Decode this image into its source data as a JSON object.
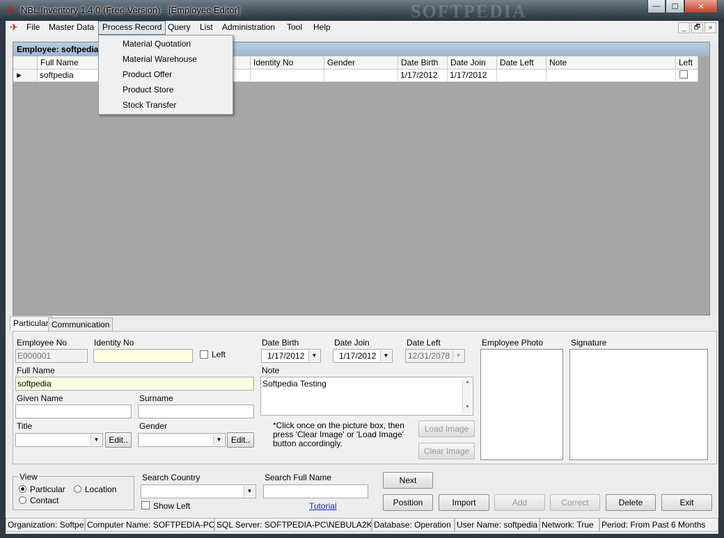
{
  "window": {
    "title": "NBL Inventory 1.4.0 (Free Version) - [Employee Editor]",
    "watermark": "SOFTPEDIA",
    "minimize": "—",
    "maximize": "☐",
    "close": "✕"
  },
  "menu": {
    "items": [
      "File",
      "Master Data",
      "Process Record",
      "Query",
      "List",
      "Administration",
      "Tool",
      "Help"
    ],
    "active": "Process Record",
    "mdi_buttons": [
      "_",
      "🗗",
      "×"
    ]
  },
  "process_record_menu": [
    "Material Quotation",
    "Material Warehouse",
    "Product Offer",
    "Product Store",
    "Stock Transfer"
  ],
  "grid": {
    "caption": "Employee: softpedia",
    "columns": [
      "Full Name",
      "Identity No",
      "Gender",
      "Date Birth",
      "Date Join",
      "Date Left",
      "Note",
      "Left"
    ],
    "rows": [
      {
        "full_name": "softpedia",
        "identity_no": "",
        "gender": "",
        "date_birth": "1/17/2012",
        "date_join": "1/17/2012",
        "date_left": "",
        "note": "",
        "left": false
      }
    ],
    "row_marker": "▶"
  },
  "tabs": [
    "Particular",
    "Communication"
  ],
  "form": {
    "employee_no_label": "Employee No",
    "employee_no": "E000001",
    "identity_no_label": "Identity No",
    "identity_no": "",
    "left_label": "Left",
    "full_name_label": "Full Name",
    "full_name": "softpedia",
    "given_name_label": "Given Name",
    "given_name": "",
    "surname_label": "Surname",
    "surname": "",
    "title_label": "Title",
    "title": "",
    "gender_label": "Gender",
    "gender": "",
    "edit_label": "Edit..",
    "date_birth_label": "Date Birth",
    "date_birth": "1/17/2012",
    "date_join_label": "Date Join",
    "date_join": "1/17/2012",
    "date_left_label": "Date Left",
    "date_left": "12/31/2078",
    "note_label": "Note",
    "note": "Softpedia Testing",
    "photo_label": "Employee Photo",
    "signature_label": "Signature",
    "image_hint": "*Click once on the picture box,  then press 'Clear Image' or 'Load Image' button accordingly.",
    "load_image": "Load Image",
    "clear_image": "Clear Image"
  },
  "bottom": {
    "view_label": "View",
    "view_particular": "Particular",
    "view_location": "Location",
    "view_contact": "Contact",
    "search_country_label": "Search Country",
    "search_country": "",
    "show_left_label": "Show Left",
    "search_full_name_label": "Search Full Name",
    "search_full_name": "",
    "tutorial": "Tutorial",
    "buttons": {
      "next": "Next",
      "position": "Position",
      "import": "Import",
      "add": "Add",
      "correct": "Correct",
      "delete": "Delete",
      "exit": "Exit"
    }
  },
  "status": {
    "organization": "Organization: Softpedia",
    "computer": "Computer Name: SOFTPEDIA-PC",
    "sql_server": "SQL Server: SOFTPEDIA-PC\\NEBULA2K",
    "database": "Database: Operation",
    "user": "User Name: softpedia",
    "network": "Network: True",
    "period": "Period: From Past 6 Months"
  }
}
